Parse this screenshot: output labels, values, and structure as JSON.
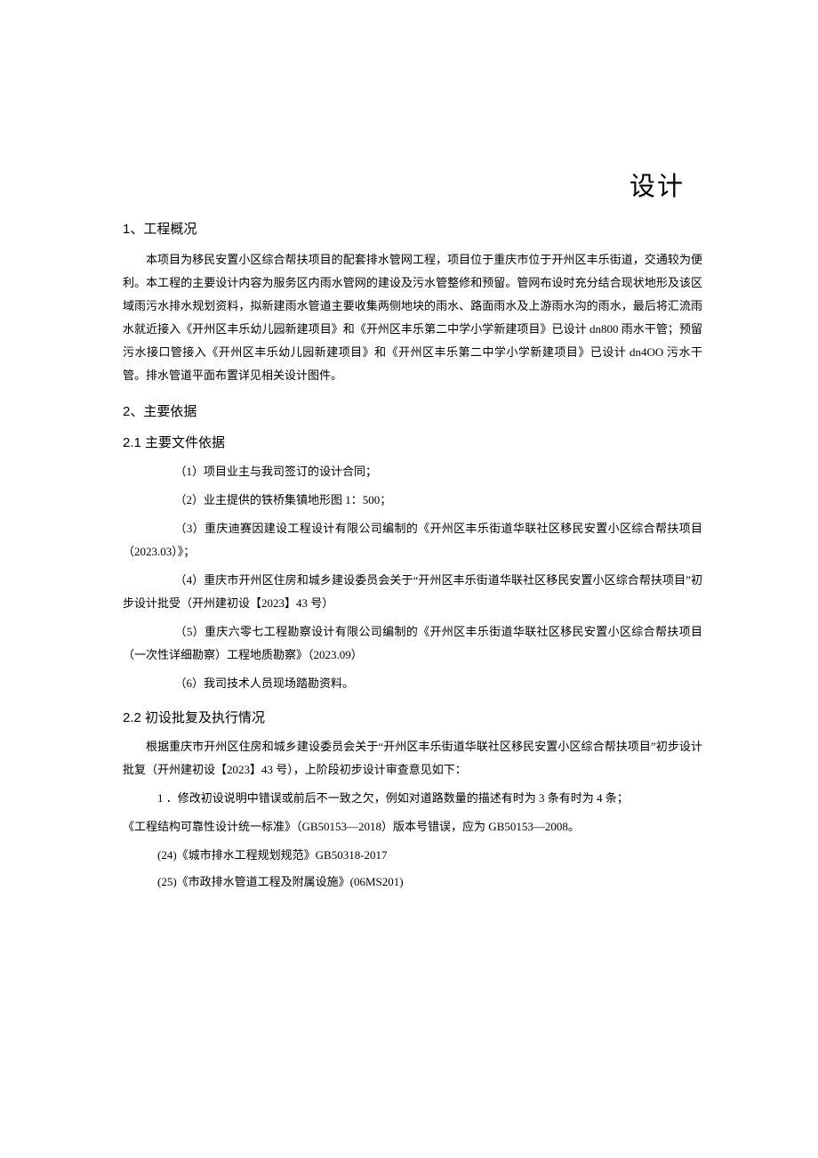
{
  "title": "设计",
  "s1": {
    "heading_num": "1、",
    "heading_text": "工程概况",
    "p1": "本项目为移民安置小区综合帮扶项目的配套排水管网工程，项目位于重庆市位于开州区丰乐街道，交通较为便利。本工程的主要设计内容为服务区内雨水管网的建设及污水管整修和预留。管网布设时充分结合现状地形及该区域雨污水排水规划资料，拟新建雨水管道主要收集两侧地块的雨水、路面雨水及上游雨水沟的雨水，最后将汇流雨水就近接入《开州区丰乐幼儿园新建项目》和《开州区丰乐第二中学小学新建项目》已设计 dn800 雨水干管；预留污水接口管接入《开州区丰乐幼儿园新建项目》和《开州区丰乐第二中学小学新建项目》已设计 dn4OO 污水干管。排水管道平面布置详见相关设计图件。"
  },
  "s2": {
    "heading_num": "2、",
    "heading_text": "主要依据",
    "sub1": {
      "num": "2.1",
      "text": "主要文件依据",
      "i1": "（1）项目业主与我司签订的设计合同；",
      "i2": "（2）业主提供的铁桥集镇地形图 1：500；",
      "i3": "（3）重庆迪赛因建设工程设计有限公司编制的《开州区丰乐街道华联社区移民安置小区综合帮扶项目（2023.03）》；",
      "i4": "（4）重庆市开州区住房和城乡建设委员会关于“开州区丰乐街道华联社区移民安置小区综合帮扶项目”初步设计批受（开州建初设【2023】43 号）",
      "i5": "（5）重庆六零七工程勘察设计有限公司编制的《开州区丰乐街道华联社区移民安置小区综合帮扶项目（一次性详细勘察）工程地质勘察》（2023.09）",
      "i6": "（6）我司技术人员现场踏勘资料。"
    },
    "sub2": {
      "num": "2.2",
      "text": "初设批复及执行情况",
      "p1": "根据重庆市开州区住房和城乡建设委员会关于“开州区丰乐街道华联社区移民安置小区综合帮扶项目”初步设计批复（开州建初设【2023】43 号），上阶段初步设计审查意见如下：",
      "li1": "1 ．修改初设说明中错误或前后不一致之欠，例如对道路数量的描述有时为 3 条有时为 4 条；",
      "gb": "《工程结构可靠性设计统一标准》（GB50153—2018）版本号错误，应为 GB50153—2008。",
      "r24": "(24)《城市排水工程规划规范》GB50318-2017",
      "r25": "(25)《市政排水管道工程及附属设施》(06MS201)"
    }
  }
}
